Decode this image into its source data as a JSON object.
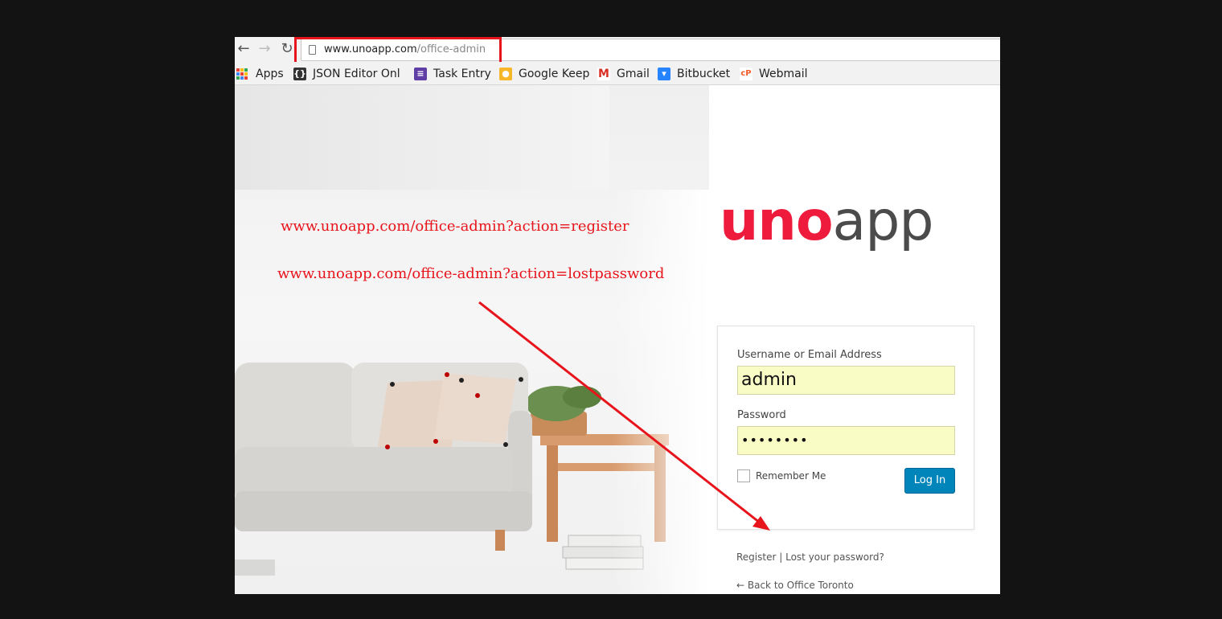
{
  "browser": {
    "url_host": "www.unoapp.com",
    "url_path": "/office-admin",
    "bookmarks": [
      {
        "label": "Apps",
        "icon": "apps-grid-icon"
      },
      {
        "label": "JSON Editor Onl",
        "icon": "json-editor-icon",
        "color": "#333333",
        "glyph": "{}"
      },
      {
        "label": "Task Entry",
        "icon": "task-list-icon",
        "color": "#5f3ea6",
        "glyph": "≡"
      },
      {
        "label": "Google Keep",
        "icon": "keep-bulb-icon",
        "color": "#f7b529",
        "glyph": "●"
      },
      {
        "label": "Gmail",
        "icon": "gmail-icon",
        "color": "#d93025",
        "glyph": "M"
      },
      {
        "label": "Bitbucket",
        "icon": "bitbucket-icon",
        "color": "#2684ff",
        "glyph": "▾"
      },
      {
        "label": "Webmail",
        "icon": "webmail-icon",
        "color": "#f25c2a",
        "glyph": "cP"
      }
    ]
  },
  "annotations": {
    "register_url": "www.unoapp.com/office-admin?action=register",
    "lostpassword_url": "www.unoapp.com/office-admin?action=lostpassword"
  },
  "logo": {
    "part1": "uno",
    "part2": "app"
  },
  "login": {
    "username_label": "Username or Email Address",
    "username_value": "admin",
    "password_label": "Password",
    "password_value": "••••••••",
    "remember_label": "Remember Me",
    "submit_label": "Log In"
  },
  "links": {
    "register": "Register",
    "separator": "|",
    "lost_password": "Lost your password?",
    "back": "← Back to Office Toronto"
  },
  "colors": {
    "brand_red": "#ee1b3c",
    "button_blue": "#0085ba",
    "annotation_red": "#e8141b",
    "autofill_yellow": "#fafcc6"
  }
}
